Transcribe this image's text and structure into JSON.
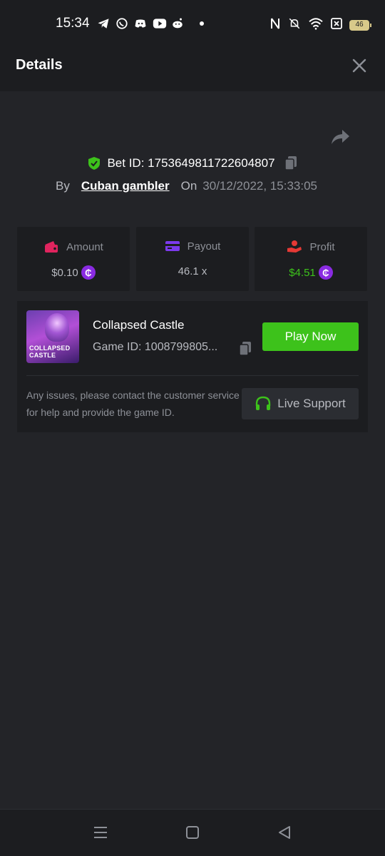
{
  "status_bar": {
    "time": "15:34",
    "battery": "46",
    "left_icons": [
      "telegram-icon",
      "whatsapp-icon",
      "discord-icon",
      "youtube-icon",
      "reddit-icon"
    ],
    "right_icons": [
      "nfc-icon",
      "mute-icon",
      "wifi-icon",
      "no-sim-icon",
      "battery-icon"
    ]
  },
  "header": {
    "title": "Details"
  },
  "bet": {
    "id_label": "Bet ID: 1753649811722604807",
    "by_label": "By",
    "username": "Cuban gambler",
    "on_label": "On",
    "date": "30/12/2022, 15:33:05"
  },
  "stats": [
    {
      "label": "Amount",
      "value": "$0.10",
      "coin": "₵",
      "color": "#b8bac0",
      "icon": "wallet-icon",
      "icon_color": "#e0245e"
    },
    {
      "label": "Payout",
      "value": "46.1 x",
      "coin": "",
      "color": "#b8bac0",
      "icon": "card-icon",
      "icon_color": "#7c3aed"
    },
    {
      "label": "Profit",
      "value": "$4.51",
      "coin": "₵",
      "color": "#3dc21b",
      "icon": "hand-coin-icon",
      "icon_color": "#e53935"
    }
  ],
  "game": {
    "title": "Collapsed Castle",
    "id_label": "Game ID: 1008799805...",
    "thumb_text_1": "COLLAPSED",
    "thumb_text_2": "CASTLE",
    "play_label": "Play Now",
    "issue_text": "Any issues, please contact the customer service for help and provide the game ID.",
    "support_label": "Live Support"
  },
  "colors": {
    "accent_green": "#3dc21b",
    "bg": "#232428",
    "card_bg": "#1c1d20"
  }
}
